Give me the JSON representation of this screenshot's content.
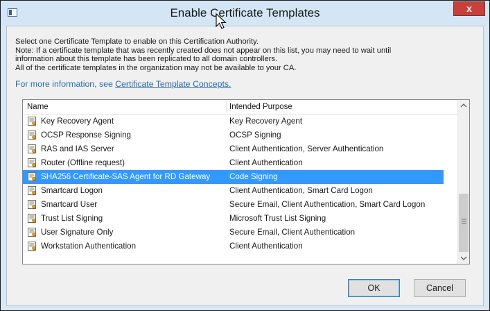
{
  "window": {
    "title": "Enable Certificate Templates",
    "close_label": "x"
  },
  "description": {
    "lines": [
      "Select one Certificate Template to enable on this Certification Authority.",
      "Note: If a certificate template that was recently created does not appear on this list, you may need to wait until",
      "information about this template has been replicated to all domain controllers.",
      "All of the certificate templates in the organization may not be available to your CA."
    ],
    "more_info_prefix": "For more information, see ",
    "more_info_link": "Certificate Template Concepts."
  },
  "list": {
    "columns": {
      "name": "Name",
      "purpose": "Intended Purpose"
    },
    "rows": [
      {
        "name": "Key Recovery Agent",
        "purpose": "Key Recovery Agent"
      },
      {
        "name": "OCSP Response Signing",
        "purpose": "OCSP Signing"
      },
      {
        "name": "RAS and IAS Server",
        "purpose": "Client Authentication, Server Authentication"
      },
      {
        "name": "Router (Offline request)",
        "purpose": "Client Authentication"
      },
      {
        "name": "SHA256 Certificate-SAS Agent for RD Gateway",
        "purpose": "Code Signing"
      },
      {
        "name": "Smartcard Logon",
        "purpose": "Client Authentication, Smart Card Logon"
      },
      {
        "name": "Smartcard User",
        "purpose": "Secure Email, Client Authentication, Smart Card Logon"
      },
      {
        "name": "Trust List Signing",
        "purpose": "Microsoft Trust List Signing"
      },
      {
        "name": "User Signature Only",
        "purpose": "Secure Email, Client Authentication"
      },
      {
        "name": "Workstation Authentication",
        "purpose": "Client Authentication"
      }
    ],
    "selected_index": 4,
    "row_icon": "certificate-template-icon",
    "selection_color": "#3399ff"
  },
  "buttons": {
    "ok": "OK",
    "cancel": "Cancel"
  },
  "colors": {
    "title_bar": "#d4e6f5",
    "close_button": "#c7403a",
    "link": "#2a6aad"
  }
}
